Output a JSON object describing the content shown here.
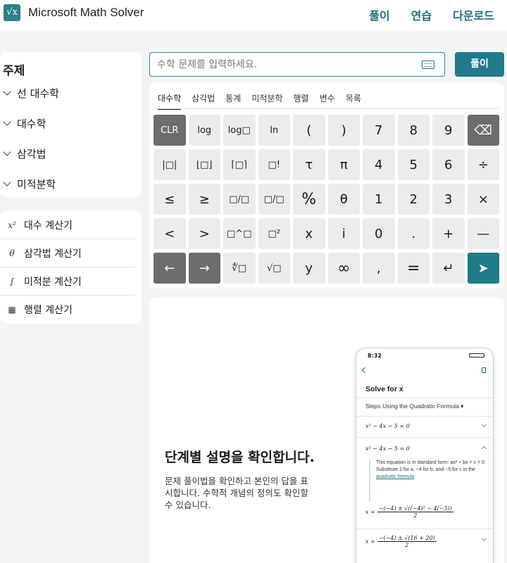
{
  "header": {
    "logo_glyph": "√x",
    "brand": "Microsoft Math Solver",
    "nav": [
      "풀이",
      "연습",
      "다운로드"
    ]
  },
  "sidebar": {
    "topics_title": "주제",
    "topics": [
      "선 대수학",
      "대수학",
      "삼각법",
      "미적분학"
    ],
    "calculators": [
      {
        "icon": "x²",
        "label": "대수 계산기"
      },
      {
        "icon": "θ",
        "label": "삼각법 계산기"
      },
      {
        "icon": "∫",
        "label": "미적분 계산기"
      },
      {
        "icon": "▦",
        "label": "행렬 계산기"
      }
    ]
  },
  "search": {
    "placeholder": "수학 문제를 입력하세요.",
    "solve_label": "풀이"
  },
  "keypad": {
    "tabs": [
      "대수학",
      "삼각법",
      "통계",
      "미적분학",
      "행렬",
      "변수",
      "목록"
    ],
    "active_tab": 0,
    "keys": [
      [
        "CLR",
        "log",
        "log□",
        "ln",
        "(",
        ")",
        "7",
        "8",
        "9",
        "⌫"
      ],
      [
        "|□|",
        "⌊□⌋",
        "⌈□⌉",
        "□!",
        "τ",
        "π",
        "4",
        "5",
        "6",
        "÷"
      ],
      [
        "≤",
        "≥",
        "□/□",
        "□/□",
        "%",
        "θ",
        "1",
        "2",
        "3",
        "×"
      ],
      [
        "<",
        ">",
        "□^□",
        "□²",
        "x",
        "i",
        "0",
        ".",
        "+",
        "—"
      ],
      [
        "←",
        "→",
        "∜□",
        "√□",
        "y",
        "∞",
        ",",
        "=",
        "↵",
        "➤"
      ]
    ]
  },
  "promo": {
    "title": "단계별 설명을 확인합니다.",
    "description": "문제 풀이법을 확인하고 본인의 답을 표시합니다. 수학적 개념의 정의도 확인할 수 있습니다."
  },
  "phone": {
    "time": "8:32",
    "title": "Solve for x",
    "method": "Steps Using the Quadratic Formula",
    "equation": "x² − 4x − 5 = 0",
    "explanation_prefix": "This equation is in standard form: ax² + bx + c = 0. Substitute 1 for a, −4 for b, and −5 for c in the",
    "explanation_link": "quadratic formula",
    "formula_lhs": "x =",
    "formula1_num": "−(−4) ± √((−4)² − 4(−5))",
    "formula1_den": "2",
    "formula2_num": "−(−4) ± √(16 + 20)",
    "formula2_den": "2"
  },
  "colors": {
    "accent": "#1f7a8a",
    "key_bg": "#ececec",
    "key_dark": "#6d6d6d"
  }
}
